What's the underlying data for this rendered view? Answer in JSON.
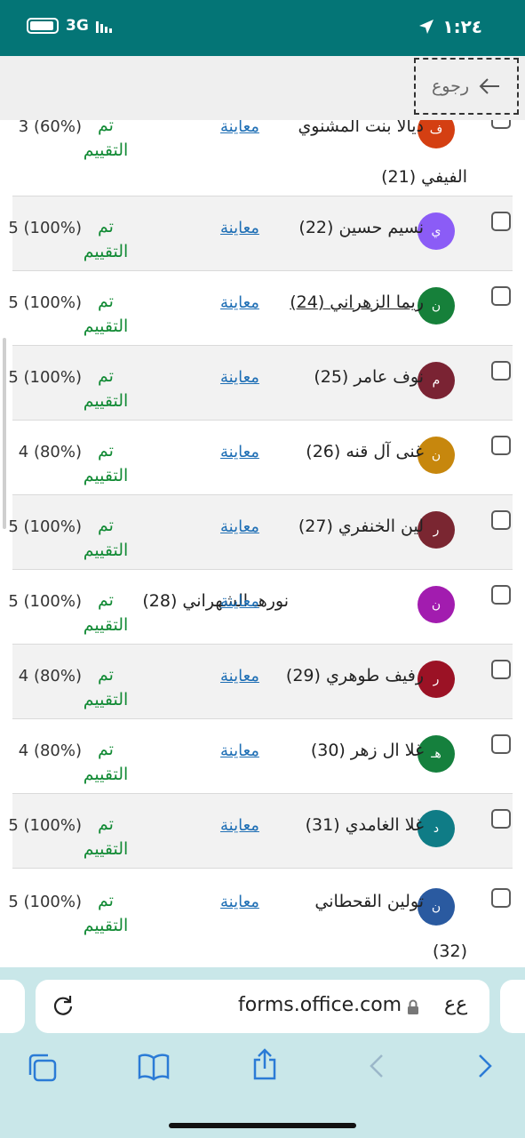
{
  "status_bar": {
    "carrier": "3G",
    "time": "١:٢٤"
  },
  "nav": {
    "back_label": "رجوع"
  },
  "rows": [
    {
      "letter": "ف",
      "color": "#d43f12",
      "name": "ديالا بنت المشنوي",
      "name2": "الفيفي (21)",
      "preview": "معاينة",
      "status": "تم التقييم",
      "score": "3 (60%)"
    },
    {
      "letter": "ي",
      "color": "#8b5cf6",
      "name": "نسيم حسين (22)",
      "preview": "معاينة",
      "status": "تم التقييم",
      "score": "5 (100%)"
    },
    {
      "letter": "ن",
      "color": "#16803a",
      "name": "ريما الزهراني (24)",
      "preview": "معاينة",
      "status": "تم التقييم",
      "score": "5 (100%)"
    },
    {
      "letter": "م",
      "color": "#7a2333",
      "name": "نوف عامر (25)",
      "preview": "معاينة",
      "status": "تم التقييم",
      "score": "5 (100%)"
    },
    {
      "letter": "ن",
      "color": "#c7870d",
      "name": "غنى آل قنه (26)",
      "preview": "معاينة",
      "status": "تم التقييم",
      "score": "4 (80%)"
    },
    {
      "letter": "ر",
      "color": "#7a2631",
      "name": "لين الخنفري (27)",
      "preview": "معاينة",
      "status": "تم التقييم",
      "score": "5 (100%)"
    },
    {
      "letter": "ن",
      "color": "#a21caf",
      "name": "نورهـ الشهراني (28)",
      "preview": "معاينة",
      "status": "تم التقييم",
      "score": "5 (100%)"
    },
    {
      "letter": "ر",
      "color": "#9b1225",
      "name": "رفيف طوهري (29)",
      "preview": "معاينة",
      "status": "تم التقييم",
      "score": "4 (80%)"
    },
    {
      "letter": "هـ",
      "color": "#15803d",
      "name": "غلا ال زهر (30)",
      "preview": "معاينة",
      "status": "تم التقييم",
      "score": "4 (80%)"
    },
    {
      "letter": "د",
      "color": "#0f7c86",
      "name": "غلا الغامدي (31)",
      "preview": "معاينة",
      "status": "تم التقييم",
      "score": "5 (100%)"
    },
    {
      "letter": "ن",
      "color": "#2a5aa0",
      "name": "تولين القحطاني",
      "name2": "(32)",
      "preview": "معاينة",
      "status": "تم التقييم",
      "score": "5 (100%)"
    }
  ],
  "browser": {
    "url": "forms.office.com",
    "text_size": "ﻉﻉ"
  }
}
